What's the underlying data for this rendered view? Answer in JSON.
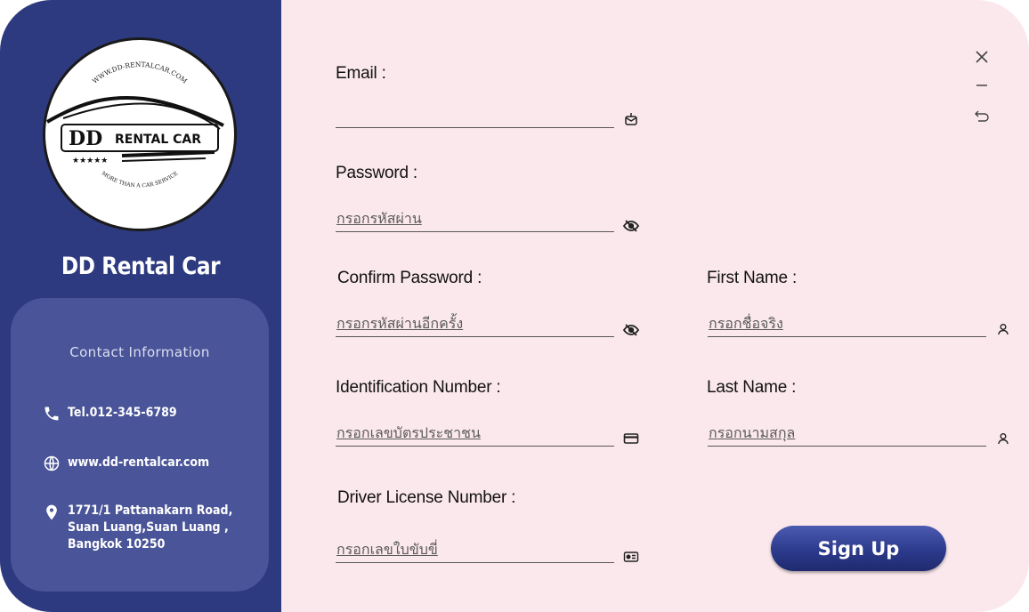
{
  "sidebar": {
    "brand_title": "DD Rental Car",
    "contact": {
      "title": "Contact Information",
      "phone": "Tel.012-345-6789",
      "website": "www.dd-rentalcar.com",
      "address_lines": [
        "1771/1 Pattanakarn Road,",
        "Suan Luang,Suan Luang ,",
        "Bangkok 10250"
      ]
    },
    "logo": {
      "top_text": "WWW.DD-RENTALCAR.COM",
      "brand_text": "DD RENTAL CAR",
      "bottom_text": "MORE THAN A CAR SERVICE"
    }
  },
  "form": {
    "email": {
      "label": "Email :",
      "placeholder": "",
      "icon": "mail-icon"
    },
    "password": {
      "label": "Password :",
      "placeholder": "กรอกรหัสผ่าน",
      "icon": "eye-slash-icon"
    },
    "confirm_password": {
      "label": "Confirm Password :",
      "placeholder": "กรอกรหัสผ่านอีกครั้ง",
      "icon": "eye-slash-icon"
    },
    "first_name": {
      "label": "First Name :",
      "placeholder": "กรอกชื่อจริง",
      "icon": "user-icon"
    },
    "id_number": {
      "label": "Identification Number :",
      "placeholder": "กรอกเลขบัตรประชาชน",
      "icon": "id-card-icon"
    },
    "last_name": {
      "label": "Last Name :",
      "placeholder": "กรอกนามสกุล",
      "icon": "user-icon"
    },
    "license_number": {
      "label": "Driver License Number :",
      "placeholder": "กรอกเลขใบขับขี่",
      "icon": "license-icon"
    },
    "signup_label": "Sign Up"
  },
  "colors": {
    "sidebar": "#2e3a80",
    "contact_card": "#4a5498",
    "form_bg": "#fbe8ec",
    "button": "#2c3a8c"
  }
}
